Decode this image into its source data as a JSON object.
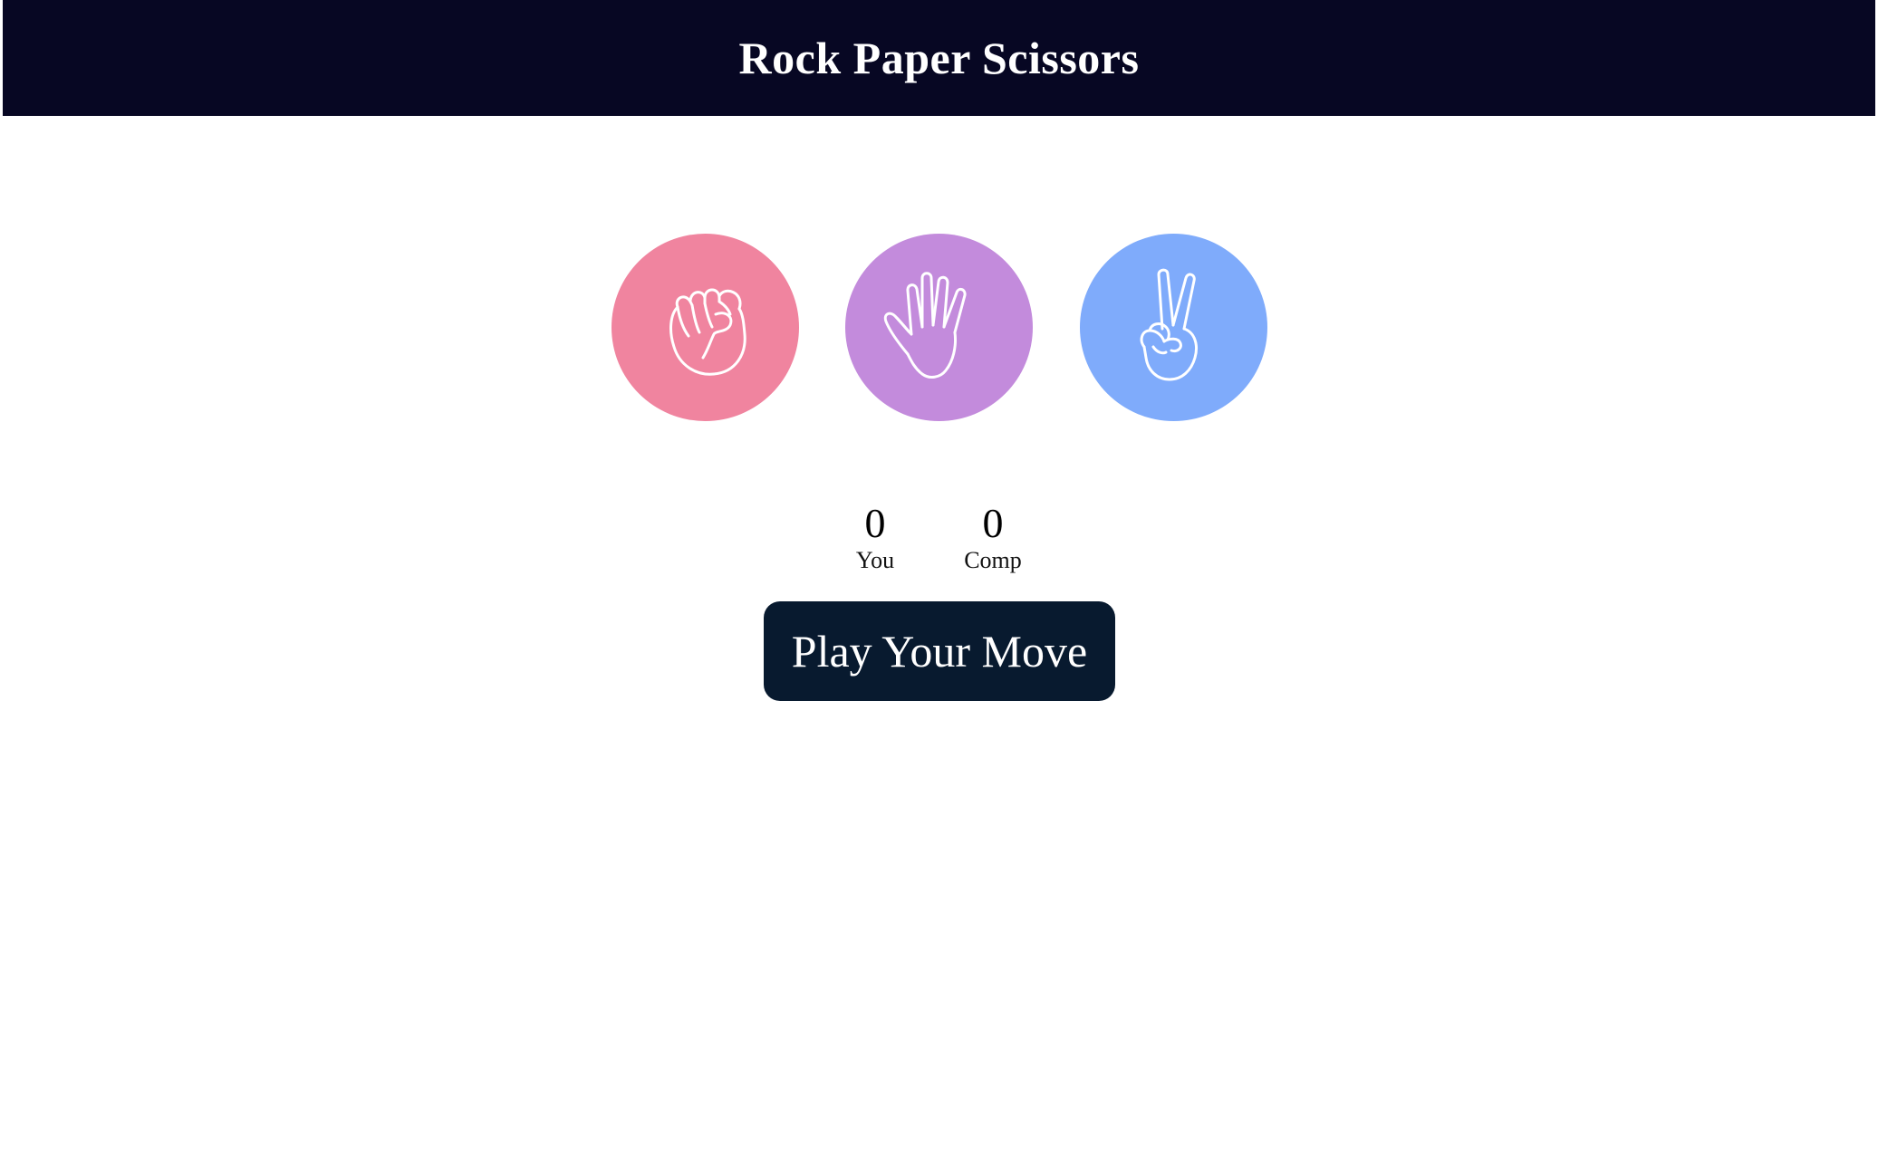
{
  "app": {
    "title": "Rock Paper Scissors"
  },
  "choices": [
    {
      "name": "rock",
      "icon": "fist-icon",
      "color": "#f0849f"
    },
    {
      "name": "paper",
      "icon": "open-hand-icon",
      "color": "#c38bdc"
    },
    {
      "name": "scissors",
      "icon": "peace-hand-icon",
      "color": "#7fabfb"
    }
  ],
  "scoreboard": {
    "you": {
      "score": "0",
      "label": "You"
    },
    "comp": {
      "score": "0",
      "label": "Comp"
    }
  },
  "play_button": {
    "label": "Play Your Move",
    "color": "#081a2f"
  },
  "colors": {
    "header_bg": "#070723",
    "page_bg": "#ffffff"
  }
}
